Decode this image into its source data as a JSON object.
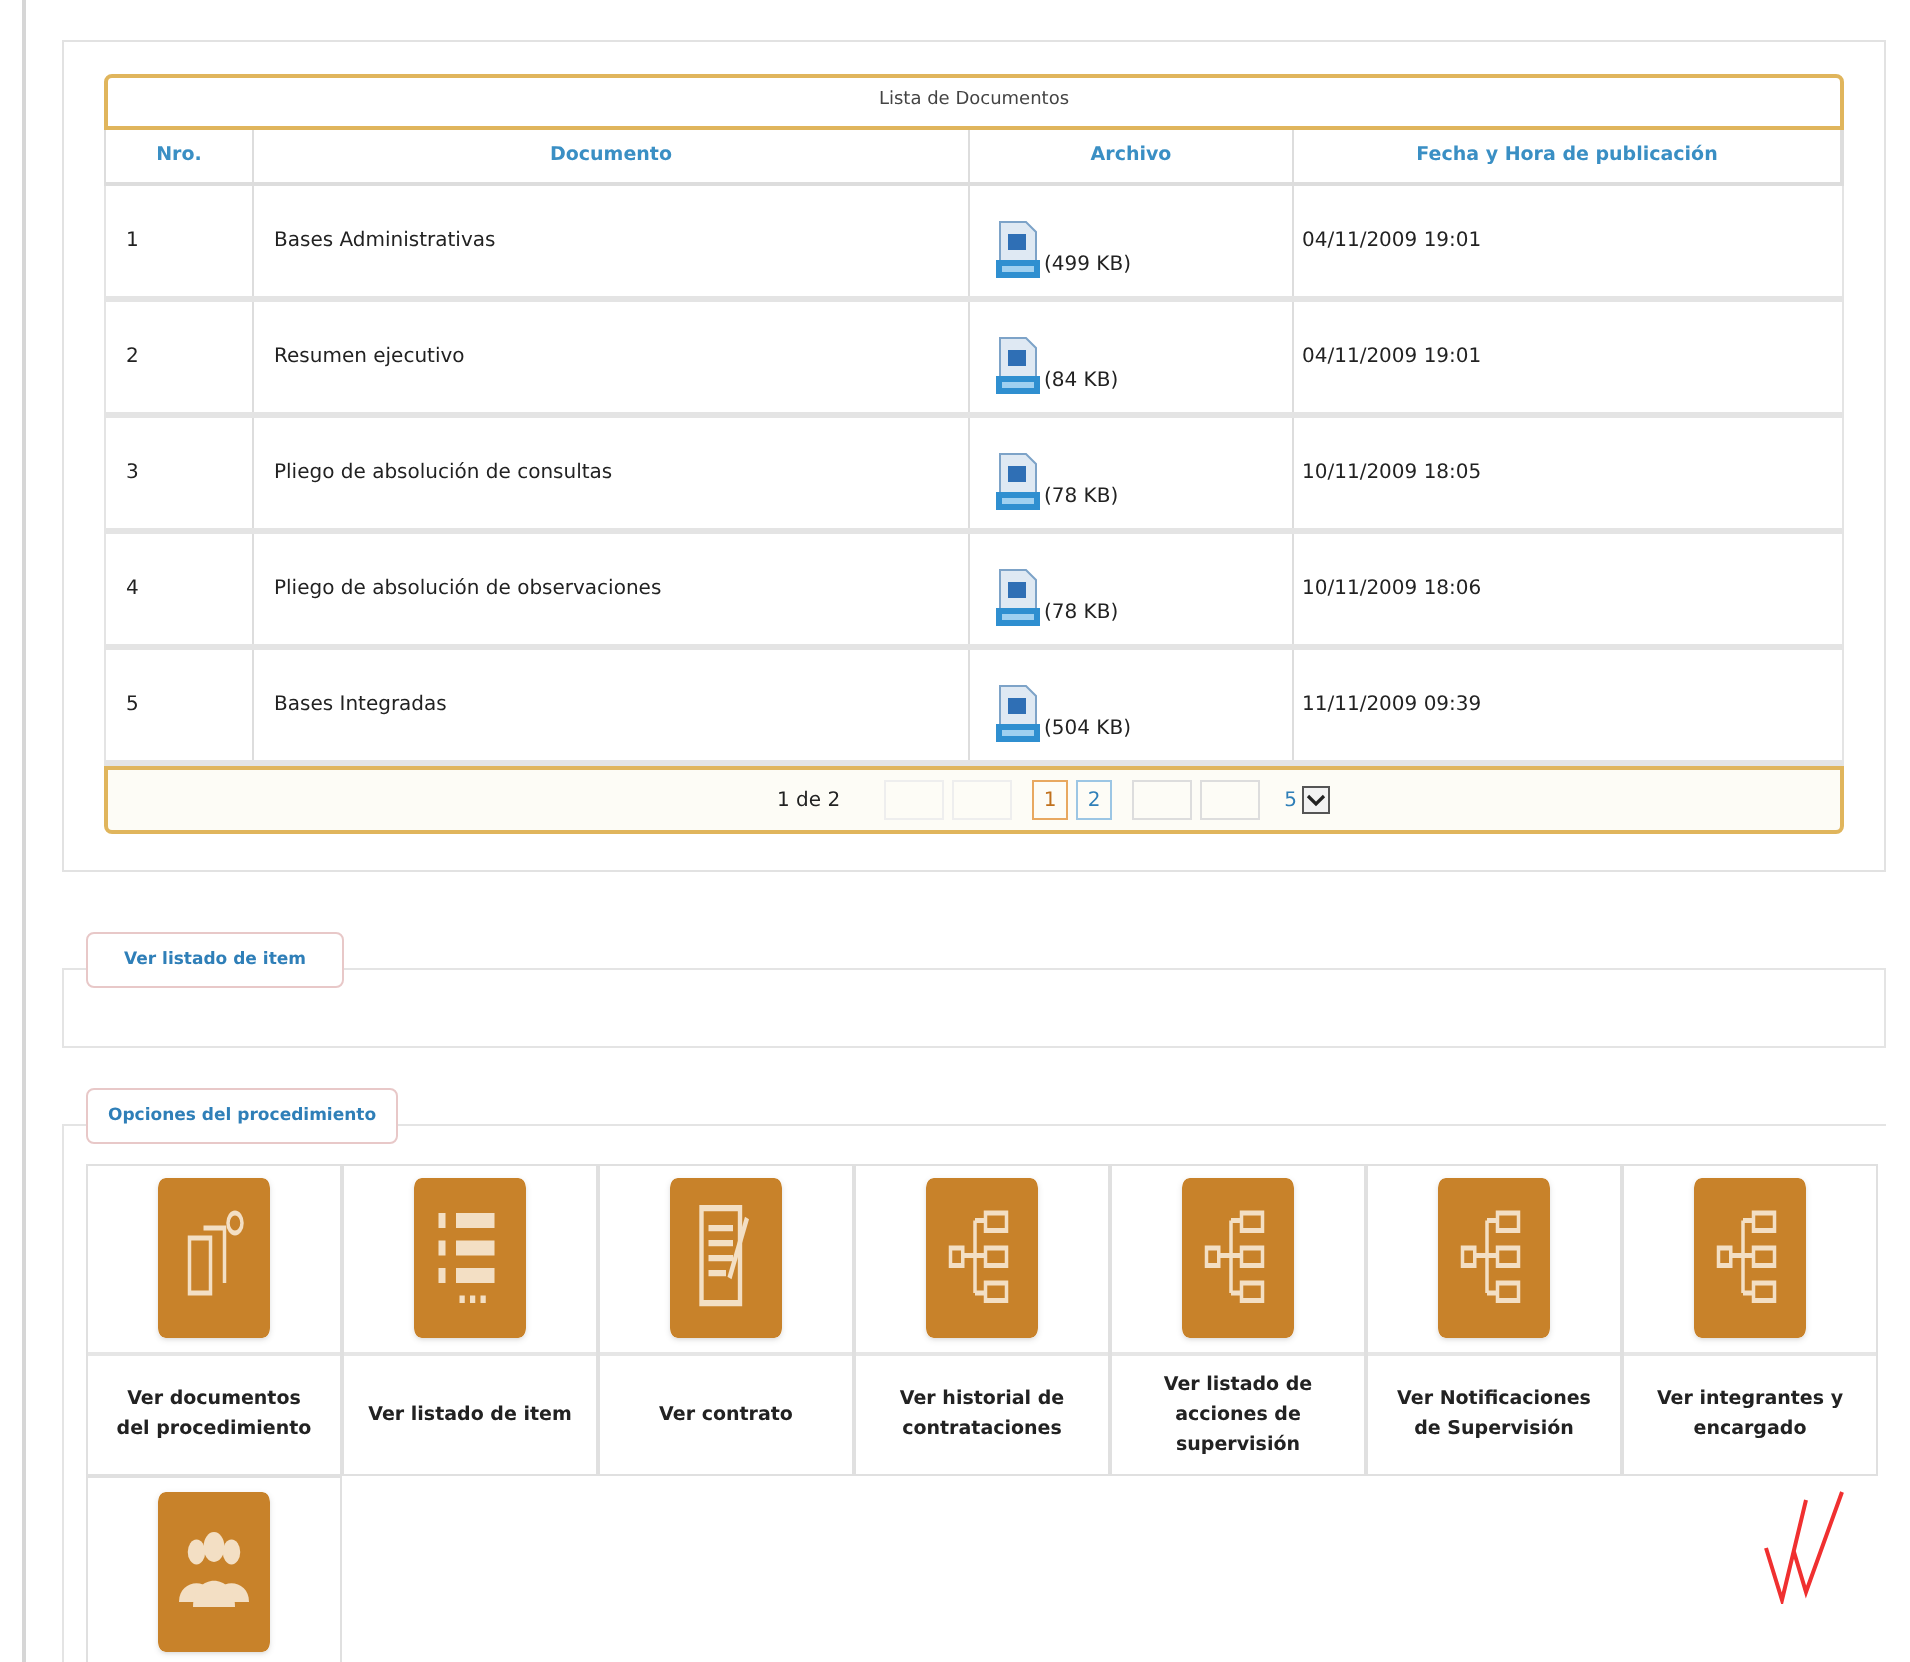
{
  "documents": {
    "title": "Lista de Documentos",
    "columns": [
      "Nro.",
      "Documento",
      "Archivo",
      "Fecha y Hora de publicación"
    ],
    "rows": [
      {
        "nro": "1",
        "documento": "Bases Administrativas",
        "archivo": "(499 KB)",
        "fecha": "04/11/2009 19:01"
      },
      {
        "nro": "2",
        "documento": "Resumen ejecutivo",
        "archivo": "(84 KB)",
        "fecha": "04/11/2009 19:01"
      },
      {
        "nro": "3",
        "documento": "Pliego de absolución de consultas",
        "archivo": "(78 KB)",
        "fecha": "10/11/2009 18:05"
      },
      {
        "nro": "4",
        "documento": "Pliego de absolución de observaciones",
        "archivo": "(78 KB)",
        "fecha": "10/11/2009 18:06"
      },
      {
        "nro": "5",
        "documento": "Bases Integradas",
        "archivo": "(504 KB)",
        "fecha": "11/11/2009 09:39"
      }
    ],
    "pagination": {
      "summary": "1 de 2",
      "pages": [
        {
          "label": "1",
          "selected": true
        },
        {
          "label": "2",
          "selected": false
        }
      ],
      "page_size": "5"
    }
  },
  "items_section": {
    "title": "Ver listado de item"
  },
  "options": {
    "title": "Opciones del procedimiento",
    "items": [
      {
        "kind": "documents",
        "label": "Ver documentos del procedimiento"
      },
      {
        "kind": "list",
        "label": "Ver listado de item"
      },
      {
        "kind": "contract",
        "label": "Ver contrato"
      },
      {
        "kind": "tree",
        "label": "Ver historial de contrataciones"
      },
      {
        "kind": "tree",
        "label": "Ver listado de acciones de supervisión"
      },
      {
        "kind": "tree",
        "label": "Ver Notificaciones de Supervisión"
      },
      {
        "kind": "tree",
        "label": "Ver integrantes y encargado"
      },
      {
        "kind": "people"
      }
    ]
  }
}
